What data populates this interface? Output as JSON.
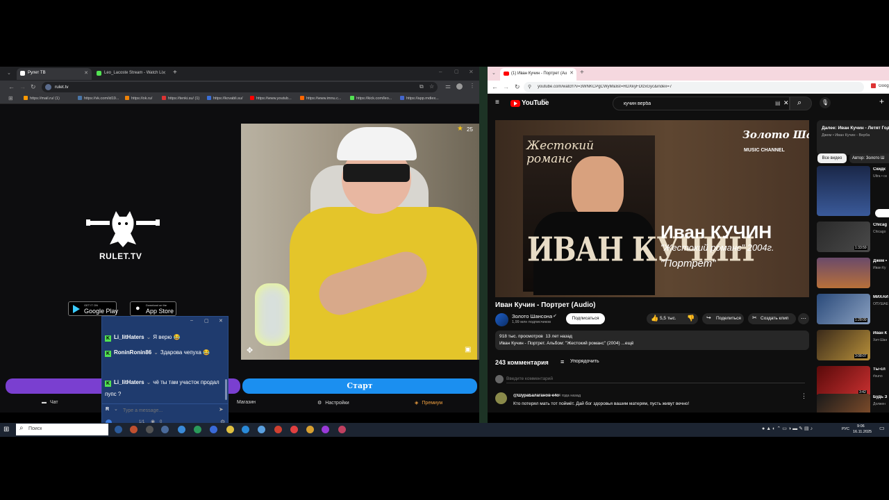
{
  "left_browser": {
    "tabs": [
      {
        "label": "Рулет ТВ"
      },
      {
        "label": "Leo_Lacoste Stream - Watch Li"
      }
    ],
    "url": "rulet.tv",
    "bookmarks": [
      "https://mail.ru/ (1)",
      "https://vk.com/id19...",
      "https://ok.ru/",
      "https://tenki.su/ (1)",
      "https://kovabli.su/",
      "https://www.youtub...",
      "https://www.imnu.c...",
      "https://kick.com/leo...",
      "https://app.rndiex..."
    ]
  },
  "rulet": {
    "brand": "RULET.TV",
    "google_play_small": "GET IT ON",
    "google_play": "Google Play",
    "app_store_small": "Download on the",
    "app_store": "App Store",
    "stars": "25",
    "start_label": "Старт",
    "nav": {
      "chat": "Чат",
      "shop": "Магазин",
      "settings": "Настройки",
      "premium": "Премиум"
    }
  },
  "chat": {
    "messages": [
      {
        "user": "Li_litHaters",
        "text": "Я верю 😂"
      },
      {
        "user": "RoninRonin86",
        "text": "Здарова чепуха 😂"
      },
      {
        "user": "Li_litHaters",
        "text": "чё ты там участок продал пупс ?"
      }
    ],
    "input_placeholder": "Type a message...",
    "counter": "1/1",
    "viewers": "0"
  },
  "right_browser": {
    "tab_label": "(1) Иван Кучин - Портрет (Au",
    "url": "youtube.com/watch?v=3WNKCPgCWyM&list=RDXkyFDlzxGyc&index=7",
    "google_label": "Goog"
  },
  "youtube": {
    "logo": "YouTube",
    "region": "MD",
    "search_value": "кучин верба",
    "thumb_title_main": "ИВАН КУЧИН",
    "thumb_name": "Иван КУЧИН",
    "thumb_sub": "\"Жестокий романс\" 2004г.",
    "thumb_song": "\"Портрет\"",
    "thumb_script": "Жестокий романс",
    "thumb_channel_brand": "Золото Шансона",
    "thumb_channel_tag": "MUSIC CHANNEL",
    "video_title": "Иван Кучин - Портрет (Audio)",
    "channel_name": "Золото Шансона",
    "subscribers": "1,99 млн подписчиков",
    "subscribe": "Подписаться",
    "likes": "5,5 тыс.",
    "share": "Поделиться",
    "clip": "Создать клип",
    "views_line": "918 тыс. просмотров  13 лет назад",
    "desc_line": "Иван Кучин - Портрет. Альбом: \"Жестокий романс\" (2004) ...ещё",
    "comments_count": "243 комментария",
    "sort": "Упорядочить",
    "comment_placeholder": "Введите комментарий",
    "comment_user": "@ШураБалаганов-е4о",
    "comment_time": "4 года назад",
    "comment_text": "Кто потерял мать тот поймёт. Дай бог здоровья вашим матерям, пусть живут вечно!",
    "next_title": "Далее: Иван Кучин - Летят Года",
    "next_sub": "Джем • Иван Кучин - Верба",
    "filter_all": "Все видео",
    "filter_author": "Автор: Золото Ш",
    "sidebar": [
      {
        "title": "Скидк",
        "meta": "Ultra • ск",
        "badge": ""
      },
      {
        "title": "Chicag",
        "meta": "Chicago",
        "badge": "1:33:59"
      },
      {
        "title": "Джем •",
        "meta": "Иван Ку",
        "badge": ""
      },
      {
        "title": "МИХАИ",
        "meta": "ОПУШАЕ",
        "badge": "1:28:09"
      },
      {
        "title": "Иван К",
        "meta": "Хит-Шан",
        "badge": "3:08:07"
      },
      {
        "title": "Ты-сл",
        "meta": "#suno",
        "badge": "3:42"
      },
      {
        "title": "Будь З",
        "meta": "Должен",
        "badge": ""
      }
    ]
  },
  "taskbar": {
    "search_placeholder": "Поиск",
    "lang": "РУС",
    "time": "9:06",
    "date": "16.11.2025"
  }
}
